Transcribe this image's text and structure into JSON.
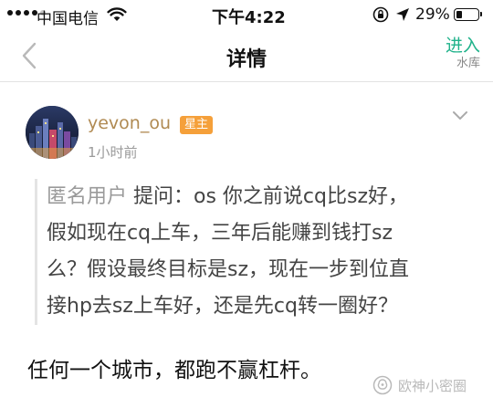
{
  "status_bar": {
    "carrier": "中国电信",
    "time": "下午4:22",
    "battery_percent_text": "29%",
    "battery_level": 0.29,
    "signal_bars_filled": 4,
    "signal_bars_total": 5,
    "icons": [
      "wifi-icon",
      "orientation-lock-icon",
      "location-icon",
      "battery-icon"
    ]
  },
  "nav": {
    "back_icon": "chevron-left-icon",
    "title": "详情",
    "enter_label": "进入",
    "enter_sub": "水库"
  },
  "post": {
    "username": "yevon_ou",
    "badge": "星主",
    "time": "1小时前",
    "more_icon": "chevron-down-icon"
  },
  "question": {
    "anon_label": "匿名用户",
    "ask_prefix": " 提问：",
    "line1": "os 你之前说cq比sz好，",
    "line2": "假如现在cq上车，三年后能赚到钱打sz",
    "line3": "么？假设最终目标是sz，现在一步到位直",
    "line4": "接hp去sz上车好，还是先cq转一圈好？"
  },
  "answer": {
    "text": "任何一个城市，都跑不赢杠杆。"
  },
  "watermark": {
    "text": "欧神小密圈",
    "icon": "wechat-official-account-icon"
  },
  "colors": {
    "accent_green": "#1fb28a",
    "username": "#b08a52",
    "badge_bg": "#f5a03a",
    "muted": "#9a9a9a"
  }
}
